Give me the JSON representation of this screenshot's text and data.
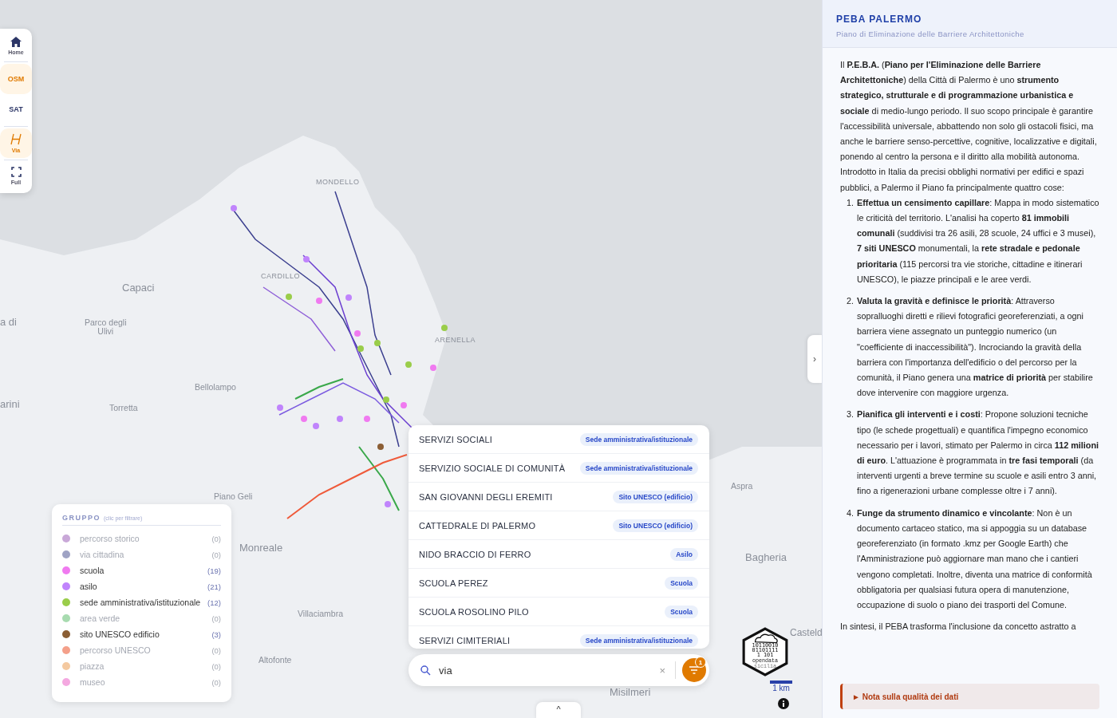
{
  "toolbar": [
    {
      "kind": "home",
      "label": "Home",
      "selected": false
    },
    {
      "kind": "text",
      "label": "OSM",
      "selected": true
    },
    {
      "kind": "text",
      "label": "SAT",
      "selected": false
    },
    {
      "kind": "via",
      "label": "Via",
      "selected": true
    },
    {
      "kind": "full",
      "label": "Full",
      "selected": false
    }
  ],
  "map": {
    "places": [
      {
        "label": "MONDELLO",
        "kind": "district"
      },
      {
        "label": "CARDILLO",
        "kind": "district"
      },
      {
        "label": "Capaci",
        "kind": "town"
      },
      {
        "label": "a di",
        "kind": "town"
      },
      {
        "label": "Parco degli\nUlivi",
        "kind": "small"
      },
      {
        "label": "ARENELLA",
        "kind": "district"
      },
      {
        "label": "Bellolampo",
        "kind": "small"
      },
      {
        "label": "arini",
        "kind": "town"
      },
      {
        "label": "Torretta",
        "kind": "small"
      },
      {
        "label": "Aspra",
        "kind": "small"
      },
      {
        "label": "Piano Geli",
        "kind": "small"
      },
      {
        "label": "Monreale",
        "kind": "town"
      },
      {
        "label": "Bagheria",
        "kind": "town"
      },
      {
        "label": "Villaciambra",
        "kind": "small"
      },
      {
        "label": "Casteld",
        "kind": "town"
      },
      {
        "label": "Altofonte",
        "kind": "small"
      },
      {
        "label": "Misilmeri",
        "kind": "town"
      }
    ]
  },
  "legend": {
    "title": "GRUPPO",
    "hint": "(clic per filtrare)",
    "items": [
      {
        "label": "percorso storico",
        "count": "(0)",
        "color": "#c9a8d8",
        "active": false
      },
      {
        "label": "via cittadina",
        "count": "(0)",
        "color": "#9fa3c4",
        "active": false
      },
      {
        "label": "scuola",
        "count": "(19)",
        "color": "#f07af0",
        "active": true
      },
      {
        "label": "asilo",
        "count": "(21)",
        "color": "#c084fc",
        "active": true
      },
      {
        "label": "sede amministrativa/istituzionale",
        "count": "(12)",
        "color": "#9acd4a",
        "active": true
      },
      {
        "label": "area verde",
        "count": "(0)",
        "color": "#a8dbb0",
        "active": false
      },
      {
        "label": "sito UNESCO edificio",
        "count": "(3)",
        "color": "#8b5e34",
        "active": true
      },
      {
        "label": "percorso UNESCO",
        "count": "(0)",
        "color": "#f4a08a",
        "active": false
      },
      {
        "label": "piazza",
        "count": "(0)",
        "color": "#f4c9a0",
        "active": false
      },
      {
        "label": "museo",
        "count": "(0)",
        "color": "#f4a8e0",
        "active": false
      }
    ]
  },
  "results": [
    {
      "name": "SERVIZI SOCIALI",
      "tag": "Sede amministrativa/istituzionale"
    },
    {
      "name": "SERVIZIO SOCIALE DI COMUNITÀ",
      "tag": "Sede amministrativa/istituzionale"
    },
    {
      "name": "SAN GIOVANNI DEGLI EREMITI",
      "tag": "Sito UNESCO (edificio)"
    },
    {
      "name": "CATTEDRALE DI PALERMO",
      "tag": "Sito UNESCO (edificio)"
    },
    {
      "name": "NIDO BRACCIO DI FERRO",
      "tag": "Asilo"
    },
    {
      "name": "SCUOLA PEREZ",
      "tag": "Scuola"
    },
    {
      "name": "SCUOLA ROSOLINO PILO",
      "tag": "Scuola"
    },
    {
      "name": "SERVIZI CIMITERIALI",
      "tag": "Sede amministrativa/istituzionale"
    }
  ],
  "search": {
    "value": "via",
    "clear": "×",
    "filter_badge": "1"
  },
  "scale": {
    "label": "1 km"
  },
  "logo": {
    "bits": [
      "10110010",
      "01101111",
      "1  101"
    ],
    "name": "opendata",
    "sub": "sicilia"
  },
  "panel": {
    "title": "PEBA PALERMO",
    "subtitle": "Piano di Eliminazione delle Barriere Architettoniche",
    "intro": [
      "Il **P.E.B.A.** (**Piano per l'Eliminazione delle Barriere Architettoniche**) della Città di Palermo è uno **strumento strategico, strutturale e di programmazione urbanistica e sociale** di medio-lungo periodo. Il suo scopo principale è garantire l'accessibilità universale, abbattendo non solo gli ostacoli fisici, ma anche le barriere senso-percettive, cognitive, localizzative e digitali, ponendo al centro la persona e il diritto alla mobilità autonoma.",
      "Introdotto in Italia da precisi obblighi normativi per edifici e spazi pubblici, a Palermo il Piano fa principalmente quattro cose:"
    ],
    "points": [
      {
        "number": "1.",
        "text": "**Effettua un censimento capillare**: Mappa in modo sistematico le criticità del territorio. L'analisi ha coperto **81 immobili comunali** (suddivisi tra 26 asili, 28 scuole, 24 uffici e 3 musei), **7 siti UNESCO** monumentali, la **rete stradale e pedonale prioritaria** (115 percorsi tra vie storiche, cittadine e itinerari UNESCO), le piazze principali e le aree verdi."
      },
      {
        "number": "2.",
        "text": "**Valuta la gravità e definisce le priorità**: Attraverso sopralluoghi diretti e rilievi fotografici georeferenziati, a ogni barriera viene assegnato un punteggio numerico (un \"coefficiente di inaccessibilità\"). Incrociando la gravità della barriera con l'importanza dell'edificio o del percorso per la comunità, il Piano genera una **matrice di priorità** per stabilire dove intervenire con maggiore urgenza."
      },
      {
        "number": "3.",
        "text": "**Pianifica gli interventi e i costi**: Propone soluzioni tecniche tipo (le schede progettuali) e quantifica l'impegno economico necessario per i lavori, stimato per Palermo in circa **112 milioni di euro**. L'attuazione è programmata in **tre fasi temporali** (da interventi urgenti a breve termine su scuole e asili entro 3 anni, fino a rigenerazioni urbane complesse oltre i 7 anni)."
      },
      {
        "number": "4.",
        "text": "**Funge da strumento dinamico e vincolante**: Non è un documento cartaceo statico, ma si appoggia su un database georeferenziato (in formato .kmz per Google Earth) che l'Amministrazione può aggiornare man mano che i cantieri vengono completati. Inoltre, diventa una matrice di conformità obbligatoria per qualsiasi futura opera di manutenzione, occupazione di suolo o piano dei trasporti del Comune."
      }
    ],
    "outro": "In sintesi, il PEBA trasforma l'inclusione da concetto astratto a",
    "note": {
      "marker": "►",
      "label": "Nota sulla qualità dei dati"
    },
    "collapse": "›"
  },
  "bottom_toggle": "^"
}
